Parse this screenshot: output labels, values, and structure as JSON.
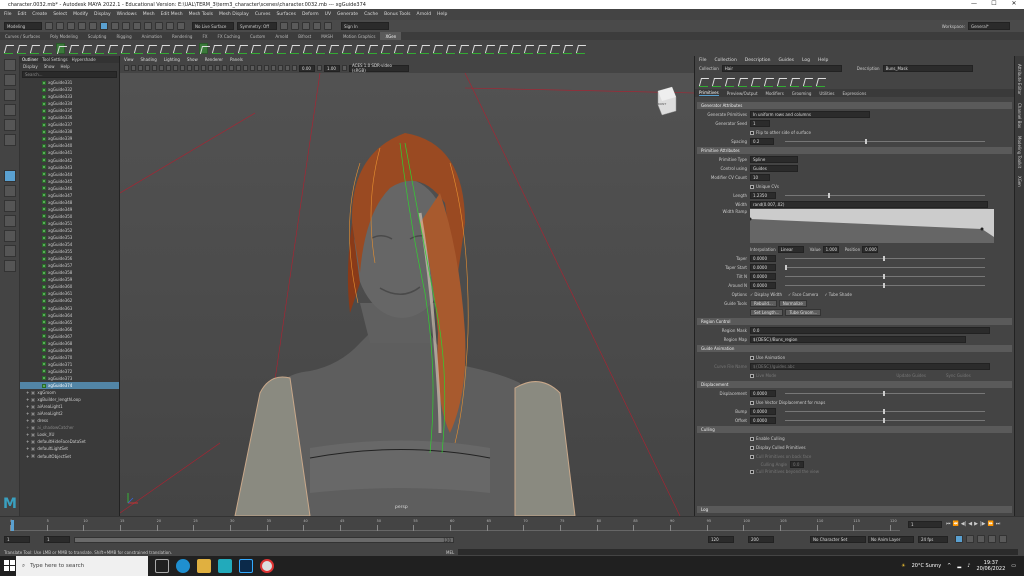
{
  "window": {
    "title": "character.0032.mb* - Autodesk MAYA 2022.1 - Educational Version: E:\\UAL\\TERM_3\\term3_character\\scenes\\character.0032.mb  ---  xgGuide374"
  },
  "menubar": [
    "File",
    "Edit",
    "Create",
    "Select",
    "Modify",
    "Display",
    "Windows",
    "Mesh",
    "Edit Mesh",
    "Mesh Tools",
    "Mesh Display",
    "Curves",
    "Surfaces",
    "Deform",
    "UV",
    "Generate",
    "Cache",
    "Bonus Tools",
    "Arnold",
    "Help"
  ],
  "workspace": {
    "label": "Workspace:",
    "value": "General*"
  },
  "statusline": {
    "mode": "Modeling",
    "surface": "No Live Surface",
    "symmetry": "Symmetry: Off",
    "signin": "Sign In"
  },
  "shelf_tabs": [
    "Curves / Surfaces",
    "Poly Modeling",
    "Sculpting",
    "Rigging",
    "Animation",
    "Rendering",
    "FX",
    "FX Caching",
    "Custom",
    "Arnold",
    "Bifrost",
    "MASH",
    "Motion Graphics",
    "XGen"
  ],
  "shelf_active": "XGen",
  "outliner": {
    "tabs": [
      "Outliner",
      "Tool Settings",
      "Hypershade"
    ],
    "menu": [
      "Display",
      "Show",
      "Help"
    ],
    "search_placeholder": "Search...",
    "items": [
      "xgGuide331",
      "xgGuide332",
      "xgGuide333",
      "xgGuide334",
      "xgGuide335",
      "xgGuide336",
      "xgGuide337",
      "xgGuide338",
      "xgGuide339",
      "xgGuide340",
      "xgGuide341",
      "xgGuide342",
      "xgGuide343",
      "xgGuide344",
      "xgGuide345",
      "xgGuide346",
      "xgGuide347",
      "xgGuide348",
      "xgGuide349",
      "xgGuide350",
      "xgGuide351",
      "xgGuide352",
      "xgGuide353",
      "xgGuide354",
      "xgGuide355",
      "xgGuide356",
      "xgGuide357",
      "xgGuide358",
      "xgGuide359",
      "xgGuide360",
      "xgGuide361",
      "xgGuide362",
      "xgGuide363",
      "xgGuide364",
      "xgGuide365",
      "xgGuide366",
      "xgGuide367",
      "xgGuide368",
      "xgGuide369",
      "xgGuide370",
      "xgGuide371",
      "xgGuide372",
      "xgGuide373",
      "xgGuide374"
    ],
    "selected": "xgGuide374",
    "extra_items": [
      "xgGroom",
      "xgBuilder_lengthLoop",
      "aiAreaLight1",
      "aiAreaLight2",
      "dress",
      "ai_shadowCatcher",
      "Look_XU",
      "defaultHideFaceDataSet",
      "defaultLightSet",
      "defaultObjectSet"
    ]
  },
  "viewport": {
    "menu": [
      "View",
      "Shading",
      "Lighting",
      "Show",
      "Renderer",
      "Panels"
    ],
    "field1": "0.00",
    "field2": "1.00",
    "colorspace": "ACES 1.0 SDR-video (sRGB)",
    "camera": "persp",
    "cube_label": "FRONT"
  },
  "xgen": {
    "menu": [
      "File",
      "Collection",
      "Description",
      "Guides",
      "Log",
      "Help"
    ],
    "collection_label": "Collection",
    "collection_value": "Hair",
    "description_label": "Description",
    "description_value": "Buns_Mask",
    "tabs": [
      "Primitives",
      "Preview/Output",
      "Modifiers",
      "Grooming",
      "Utilities",
      "Expressions"
    ],
    "active_tab": "Primitives",
    "generator": {
      "title": "Generator Attributes",
      "generate_label": "Generate Primitives",
      "generate_value": "In uniform rows and columns",
      "seed_label": "Generator Seed",
      "seed_value": "1",
      "flip_label": "Flip to other side of surface",
      "spacing_label": "Spacing",
      "spacing_value": "0.2"
    },
    "primitive": {
      "title": "Primitive Attributes",
      "type_label": "Primitive Type",
      "type_value": "Spline",
      "control_label": "Control using",
      "control_value": "Guides",
      "cvcount_label": "Modifier CV Count",
      "cvcount_value": "10",
      "unique_label": "Unique CVs",
      "length_label": "Length",
      "length_value": "1.2350",
      "width_label": "Width",
      "width_value": "rand(0.007,.02)",
      "ramp_label": "Width Ramp",
      "interp_label": "Interpolation",
      "interp_value": "Linear",
      "value_label": "Value",
      "value_value": "1.000",
      "position_label": "Position",
      "position_value": "0.000",
      "taper_label": "Taper",
      "taper_value": "0.0000",
      "taperstart_label": "Taper Start",
      "taperstart_value": "0.0000",
      "tilts_label": "Tilt N",
      "tilts_value": "0.0000",
      "around_label": "Around N",
      "around_value": "0.0000",
      "options_label": "Options",
      "opt_display_width": "Display Width",
      "opt_face_camera": "Face Camera",
      "opt_tube_shade": "Tube Shade",
      "guide_tools_label": "Guide Tools",
      "rebuild": "Rebuild...",
      "normalize": "Normalize",
      "set_length": "Set Length...",
      "tube_groom": "Tube Groom..."
    },
    "region": {
      "title": "Region Control",
      "mask_label": "Region Mask",
      "mask_value": "0.0",
      "map_label": "Region Map",
      "map_value": "${DESC}/Buns_region"
    },
    "guide_anim": {
      "title": "Guide Animation",
      "use_label": "Use Animation",
      "curve_label": "Curve File Name",
      "curve_value": "${DESC}/guides.abc",
      "live_label": "Live Mode",
      "update_label": "Update Guides",
      "sync_label": "Sync Guides"
    },
    "displacement": {
      "title": "Displacement",
      "disp_label": "Displacement",
      "disp_value": "0.0000",
      "vector_label": "Use Vector Displacement for maps",
      "bump_label": "Bump",
      "bump_value": "0.0000",
      "offset_label": "Offset",
      "offset_value": "0.0000"
    },
    "culling": {
      "title": "Culling",
      "enable_label": "Enable Culling",
      "display_label": "Display Culled Primitives",
      "backface_label": "Cull Primitives on back face",
      "angle_label": "Culling Angle",
      "angle_value": "0.0",
      "beyond_label": "Cull Primitives beyond the view"
    },
    "log_label": "Log"
  },
  "side_tabs": [
    "Attribute Editor",
    "Channel Box",
    "Modeling Toolkit",
    "XGen"
  ],
  "timeline": {
    "ticks": [
      "0",
      "5",
      "10",
      "15",
      "20",
      "25",
      "30",
      "35",
      "40",
      "45",
      "50",
      "55",
      "60",
      "65",
      "70",
      "75",
      "80",
      "85",
      "90",
      "95",
      "100",
      "105",
      "110",
      "115",
      "120"
    ],
    "current": "1",
    "range_start": "1",
    "range_start2": "1",
    "range_end": "120",
    "range_end2": "120",
    "max": "200",
    "character": "No Character Set",
    "anim_layer": "No Anim Layer",
    "fps": "24 fps"
  },
  "mel_label": "MEL",
  "helpline": "Translate Tool: Use LMB or MMB to translate. Shift+MMB for constrained translation.",
  "taskbar": {
    "search_placeholder": "Type here to search",
    "weather": "20°C  Sunny",
    "time": "19:37",
    "date": "20/06/2022"
  }
}
